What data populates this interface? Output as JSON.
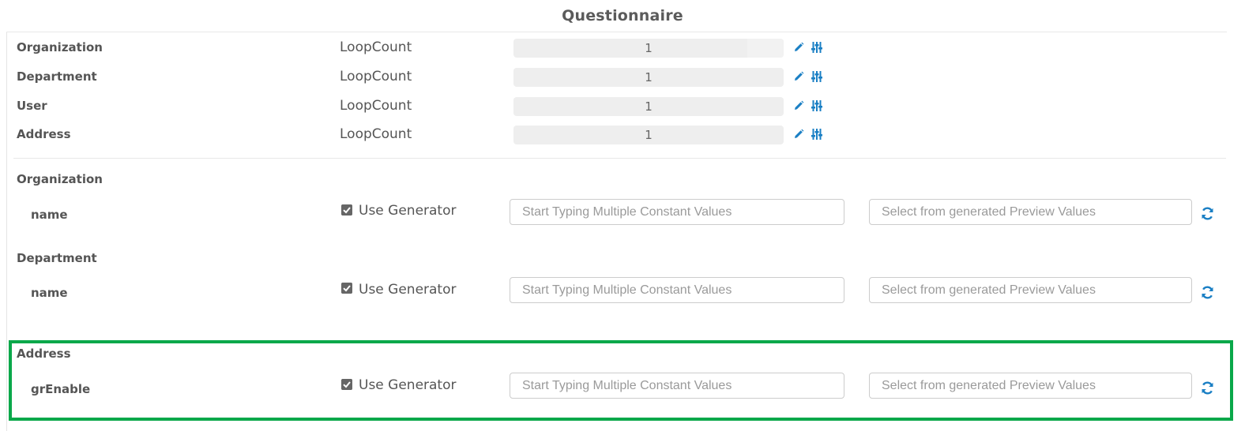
{
  "page": {
    "title": "Questionnaire"
  },
  "loop_rows": [
    {
      "entity": "Organization",
      "label": "LoopCount",
      "value": "1"
    },
    {
      "entity": "Department",
      "label": "LoopCount",
      "value": "1"
    },
    {
      "entity": "User",
      "label": "LoopCount",
      "value": "1"
    },
    {
      "entity": "Address",
      "label": "LoopCount",
      "value": "1"
    }
  ],
  "generator_sections": [
    {
      "entity": "Organization",
      "field": "name",
      "use_generator_label": "Use Generator",
      "use_generator_checked": true,
      "constant_placeholder": "Start Typing Multiple Constant Values",
      "preview_placeholder": "Select from generated Preview Values"
    },
    {
      "entity": "Department",
      "field": "name",
      "use_generator_label": "Use Generator",
      "use_generator_checked": true,
      "constant_placeholder": "Start Typing Multiple Constant Values",
      "preview_placeholder": "Select from generated Preview Values"
    },
    {
      "entity": "Address",
      "field": "grEnable",
      "use_generator_label": "Use Generator",
      "use_generator_checked": true,
      "constant_placeholder": "Start Typing Multiple Constant Values",
      "preview_placeholder": "Select from generated Preview Values"
    }
  ],
  "icons": {
    "edit": "pencil-icon",
    "settings": "sliders-icon",
    "refresh": "refresh-icon",
    "checkbox": "checkbox-checked-icon"
  },
  "colors": {
    "accent": "#1a7fc4",
    "highlight": "#0aa84a",
    "text": "#555555"
  }
}
